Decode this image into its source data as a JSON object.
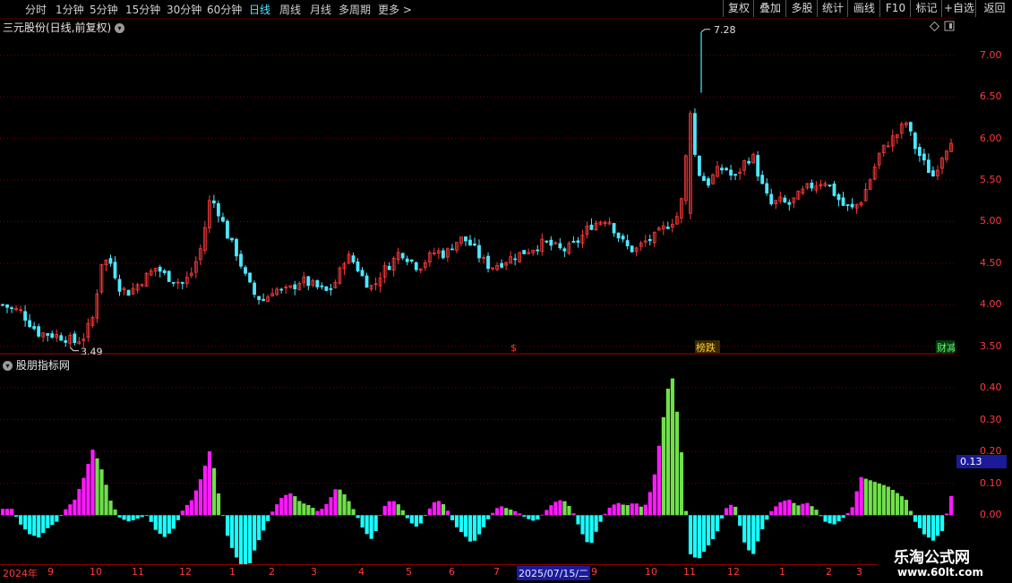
{
  "toolbar": {
    "periods": [
      {
        "label": "分时",
        "active": false
      },
      {
        "label": "1分钟",
        "active": false
      },
      {
        "label": "5分钟",
        "active": false
      },
      {
        "label": "15分钟",
        "active": false
      },
      {
        "label": "30分钟",
        "active": false
      },
      {
        "label": "60分钟",
        "active": false
      },
      {
        "label": "日线",
        "active": true
      },
      {
        "label": "周线",
        "active": false
      },
      {
        "label": "月线",
        "active": false
      },
      {
        "label": "多周期",
        "active": false
      }
    ],
    "more_label": "更多 >",
    "actions": [
      "复权",
      "叠加",
      "多股",
      "统计",
      "画线",
      "F10",
      "标记",
      "+自选",
      "返回"
    ]
  },
  "chart_title": "三元股份(日线,前复权)",
  "indicator_title": "股朋指标网",
  "price_axis": {
    "ticks": [
      "7.00",
      "6.50",
      "6.00",
      "5.50",
      "5.00",
      "4.50",
      "4.00",
      "3.50"
    ]
  },
  "indicator_axis": {
    "ticks": [
      "0.40",
      "0.30",
      "0.20",
      "0.10",
      "0.00"
    ],
    "current": "0.13"
  },
  "annotations": {
    "high": "7.28",
    "low": "3.49",
    "flag_s": "$",
    "flag_bang": "榜跌",
    "flag_cai": "财减"
  },
  "date_axis": {
    "labels": [
      "2024年",
      "9",
      "10",
      "11",
      "12",
      "1",
      "2",
      "3",
      "4",
      "5",
      "6",
      "7",
      "2025/07/15/二",
      "9",
      "10",
      "11",
      "12",
      "1",
      "2",
      "3"
    ],
    "selected": "2025/07/15/二"
  },
  "watermark": {
    "main": "乐淘公式网",
    "url": "www.60lt.com"
  },
  "colors": {
    "up": "#ff3b3b",
    "down": "#4ee8ff",
    "positive": "#ff19ff",
    "negative": "#19ffff",
    "green": "#6fe04a",
    "grid": "#7a0000"
  },
  "chart_data": {
    "type": "candlestick",
    "price": {
      "ylim": [
        3.4,
        7.45
      ],
      "y_ticks": [
        3.5,
        4.0,
        4.5,
        5.0,
        5.5,
        6.0,
        6.5,
        7.0
      ],
      "high": 7.28,
      "low": 3.49,
      "close_path": [
        4.0,
        3.95,
        3.92,
        3.78,
        3.66,
        3.65,
        3.63,
        3.6,
        3.55,
        3.62,
        3.85,
        4.55,
        4.5,
        4.2,
        4.15,
        4.25,
        4.35,
        4.45,
        4.35,
        4.3,
        4.25,
        4.4,
        4.7,
        5.3,
        5.1,
        4.8,
        4.6,
        4.3,
        4.1,
        4.05,
        4.2,
        4.15,
        4.2,
        4.3,
        4.25,
        4.2,
        4.15,
        4.3,
        4.6,
        4.5,
        4.3,
        4.2,
        4.4,
        4.5,
        4.65,
        4.55,
        4.45,
        4.55,
        4.65,
        4.6,
        4.75,
        4.8,
        4.7,
        4.55,
        4.45,
        4.5,
        4.55,
        4.6,
        4.65,
        4.7,
        4.75,
        4.7,
        4.65,
        4.7,
        4.8,
        4.95,
        5.0,
        5.05,
        4.85,
        4.7,
        4.65,
        4.75,
        4.8,
        4.9,
        5.0,
        5.1,
        6.15,
        5.6,
        5.45,
        5.6,
        5.65,
        5.5,
        5.7,
        5.8,
        5.45,
        5.2,
        5.25,
        5.2,
        5.3,
        5.4,
        5.45,
        5.5,
        5.35,
        5.2,
        5.15,
        5.25,
        5.5,
        5.8,
        5.95,
        6.05,
        6.2,
        5.9,
        5.7,
        5.55,
        5.8,
        6.0
      ],
      "highlight_index": 76
    },
    "indicator": {
      "ylim": [
        -0.12,
        0.47
      ],
      "y_ticks": [
        0.0,
        0.1,
        0.2,
        0.3,
        0.4
      ],
      "current": 0.13,
      "bars": [
        0.02,
        0.02,
        -0.03,
        -0.06,
        -0.07,
        -0.04,
        -0.02,
        0.02,
        0.05,
        0.12,
        0.21,
        0.14,
        0.04,
        -0.01,
        -0.02,
        -0.01,
        0.0,
        -0.05,
        -0.07,
        -0.04,
        0.02,
        0.05,
        0.12,
        0.21,
        0.05,
        -0.08,
        -0.14,
        -0.18,
        -0.1,
        -0.04,
        0.02,
        0.06,
        0.07,
        0.04,
        0.03,
        0.01,
        0.04,
        0.09,
        0.06,
        0.01,
        -0.05,
        -0.08,
        0.02,
        0.05,
        0.03,
        -0.02,
        -0.04,
        0.01,
        0.05,
        0.03,
        -0.03,
        -0.06,
        -0.09,
        -0.05,
        0.0,
        0.03,
        0.02,
        0.01,
        -0.01,
        -0.02,
        0.01,
        0.04,
        0.05,
        0.02,
        -0.05,
        -0.1,
        -0.03,
        0.02,
        0.04,
        0.03,
        0.04,
        0.02,
        0.1,
        0.28,
        0.46,
        0.25,
        -0.12,
        -0.14,
        -0.1,
        -0.06,
        0.02,
        0.04,
        -0.08,
        -0.13,
        -0.05,
        0.01,
        0.04,
        0.05,
        0.03,
        0.04,
        0.02,
        -0.02,
        -0.03,
        -0.01,
        0.02,
        0.12,
        0.11,
        0.1,
        0.09,
        0.07,
        0.05,
        -0.02,
        -0.06,
        -0.08,
        -0.05,
        0.06
      ],
      "green_start": [
        11,
        24,
        73,
        100
      ]
    }
  }
}
